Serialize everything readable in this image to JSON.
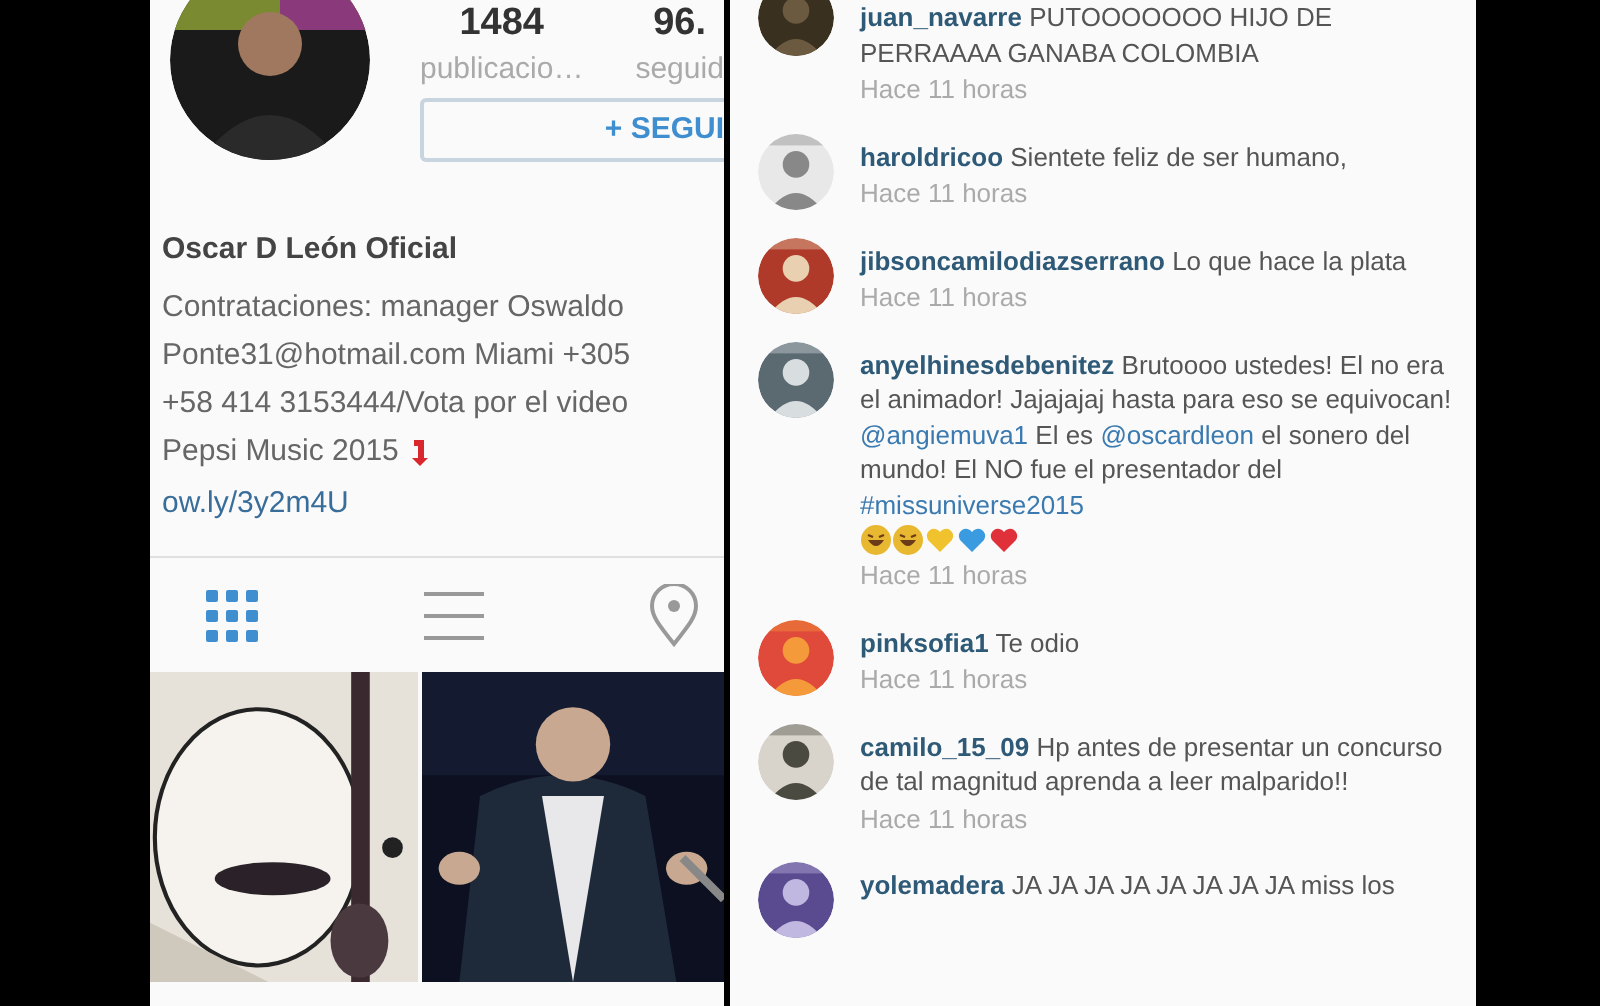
{
  "profile": {
    "stats": [
      {
        "value": "1484",
        "label": "publicacio…"
      },
      {
        "value": "96.",
        "label": "seguid"
      }
    ],
    "follow_button": "+ SEGUI",
    "name": "Oscar D León Oficial",
    "bio_lines": [
      "Contrataciones: manager Oswaldo",
      "Ponte31@hotmail.com Miami +305",
      "+58 414 3153444/Vota por el video",
      "Pepsi Music 2015"
    ],
    "link": "ow.ly/3y2m4U",
    "tabs": [
      {
        "kind": "grid",
        "selected": true
      },
      {
        "kind": "list",
        "selected": false
      },
      {
        "kind": "place",
        "selected": false
      }
    ],
    "posts": [
      {
        "kind": "picture"
      },
      {
        "kind": "picture"
      }
    ]
  },
  "comments": [
    {
      "user": "juan_navarre",
      "parts": [
        {
          "kind": "plain",
          "text": "PUTOOOOOOO HIJO DE PERRAAAA GANABA COLOMBIA"
        }
      ],
      "time": "Hace 11 horas"
    },
    {
      "user": "haroldricoo",
      "parts": [
        {
          "kind": "plain",
          "text": "Sientete feliz de ser humano,"
        }
      ],
      "time": "Hace 11 horas"
    },
    {
      "user": "jibsoncamilodiazserrano",
      "parts": [
        {
          "kind": "plain",
          "text": "Lo que hace la plata"
        }
      ],
      "time": "Hace 11 horas"
    },
    {
      "user": "anyelhinesdebenitez",
      "parts": [
        {
          "kind": "plain",
          "text": "Brutoooo ustedes! El no era el animador! Jajajajaj hasta para eso se equivocan!"
        },
        {
          "kind": "tag",
          "text": "@angiemuva1"
        },
        {
          "kind": "plain",
          "text": "El es"
        },
        {
          "kind": "tag",
          "text": "@oscardleon"
        },
        {
          "kind": "plain",
          "text": "el sonero del mundo! El NO fue el presentador del"
        },
        {
          "kind": "tag",
          "text": "#missuniverse2015"
        }
      ],
      "reactions": [
        {
          "kind": "laugh"
        },
        {
          "kind": "laugh"
        },
        {
          "kind": "heart",
          "color": "#f0c22e"
        },
        {
          "kind": "heart",
          "color": "#3a9be0"
        },
        {
          "kind": "heart",
          "color": "#e0303a"
        }
      ],
      "time": "Hace 11 horas"
    },
    {
      "user": "pinksofia1",
      "parts": [
        {
          "kind": "plain",
          "text": "Te odio"
        }
      ],
      "time": "Hace 11 horas"
    },
    {
      "user": "camilo_15_09",
      "parts": [
        {
          "kind": "plain",
          "text": "Hp antes de presentar un concurso de tal magnitud aprenda a leer malparido!!"
        }
      ],
      "time": "Hace 11 horas"
    },
    {
      "user": "yolemadera",
      "parts": [
        {
          "kind": "plain",
          "text": "JA JA JA JA JA JA JA JA miss los"
        }
      ]
    }
  ]
}
